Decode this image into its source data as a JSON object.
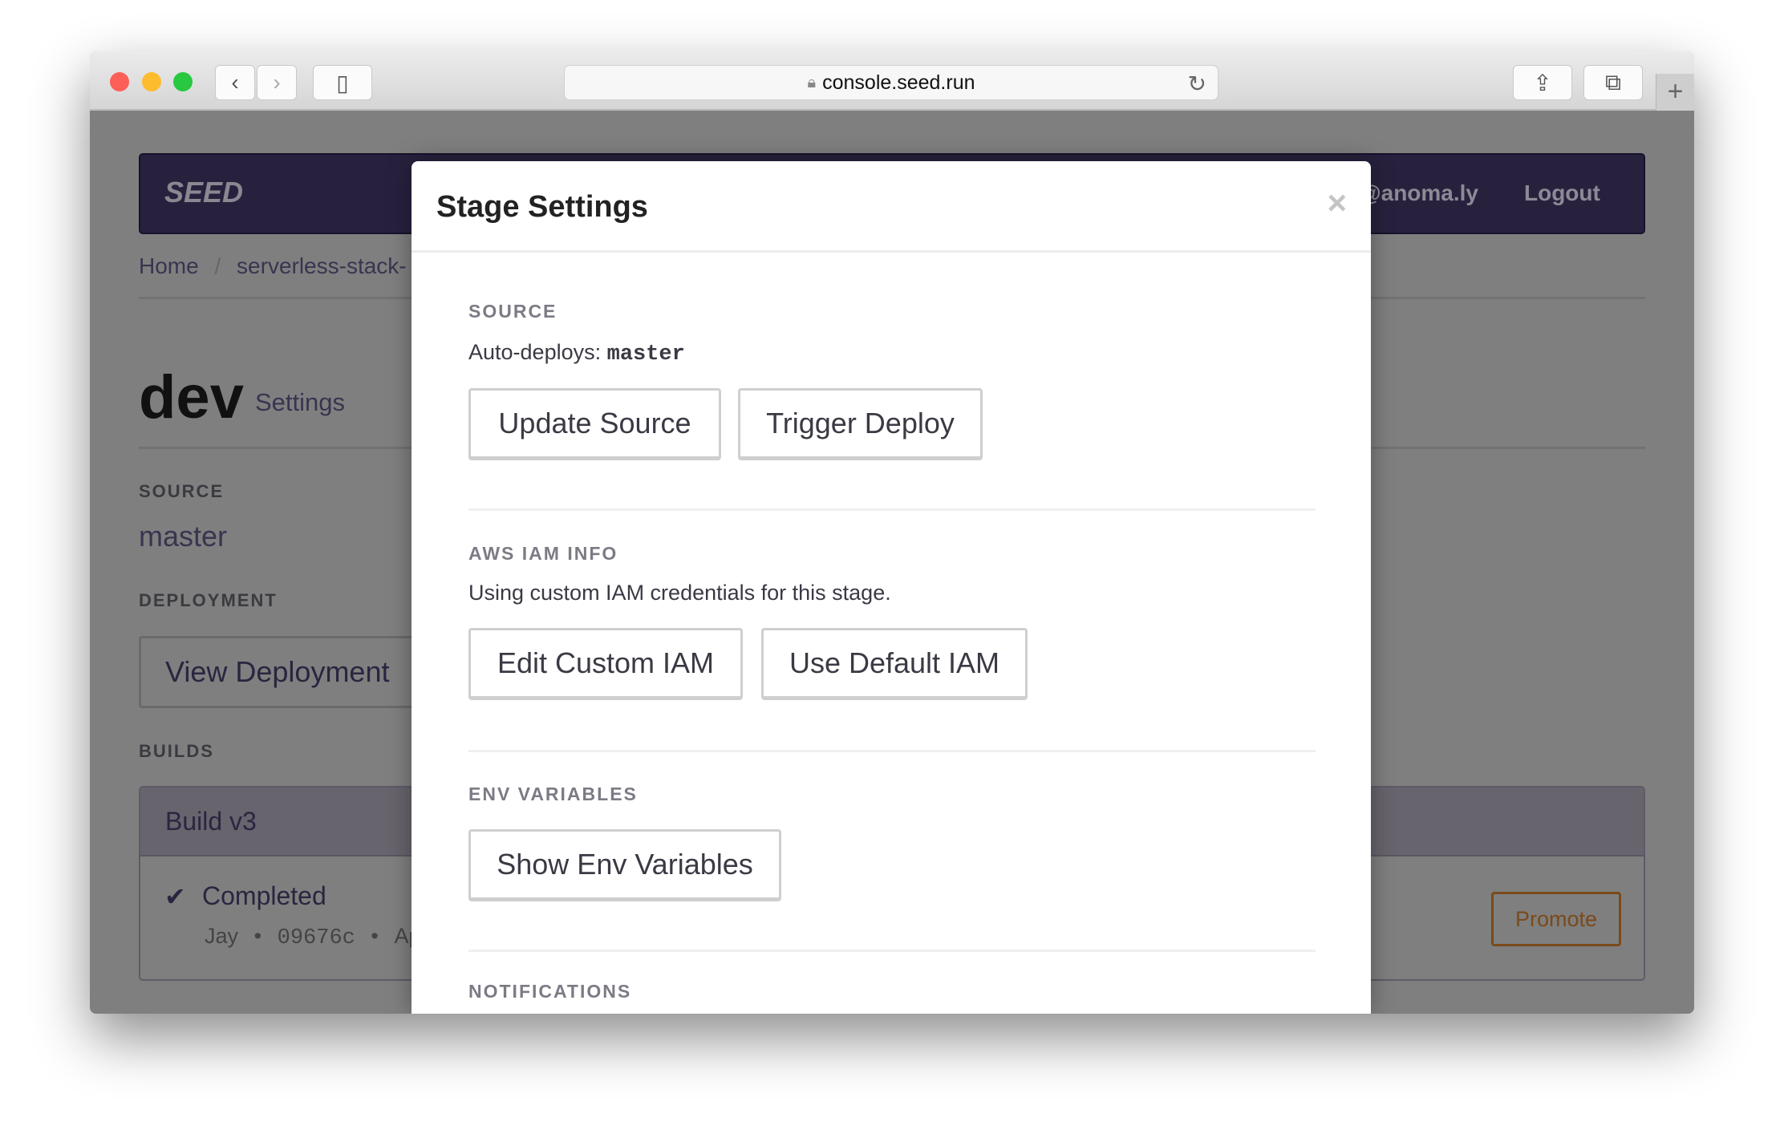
{
  "browser": {
    "url": "console.seed.run",
    "icons": [
      "back-icon",
      "forward-icon",
      "sidebar-icon",
      "lock-icon",
      "reload-icon",
      "share-icon",
      "tabs-icon",
      "new-tab-icon"
    ]
  },
  "navbar": {
    "logo": "SEED",
    "user": "@anoma.ly",
    "logout": "Logout"
  },
  "breadcrumb": {
    "home": "Home",
    "separator": "/",
    "app": "serverless-stack-"
  },
  "page": {
    "title": "dev",
    "subtitle": "Settings",
    "source_label": "SOURCE",
    "source_value": "master",
    "deployment_label": "DEPLOYMENT",
    "view_deployment": "View Deployment",
    "builds_label": "BUILDS"
  },
  "build": {
    "title": "Build v3",
    "status": "Completed",
    "meta_author": "Jay",
    "meta_commit": "09676c",
    "meta_rest": "Ap",
    "promote": "Promote"
  },
  "modal": {
    "title": "Stage Settings",
    "close": "×",
    "source": {
      "label": "SOURCE",
      "text_prefix": "Auto-deploys:",
      "branch": "master",
      "update": "Update Source",
      "trigger": "Trigger Deploy"
    },
    "iam": {
      "label": "AWS IAM INFO",
      "text": "Using custom IAM credentials for this stage.",
      "edit": "Edit Custom IAM",
      "default": "Use Default IAM"
    },
    "env": {
      "label": "ENV VARIABLES",
      "show": "Show Env Variables"
    },
    "notifications": {
      "label": "NOTIFICATIONS"
    }
  },
  "colors": {
    "navbar": "#28213e",
    "promote": "#7a4a1a",
    "overlay": "#7f7f7f"
  }
}
